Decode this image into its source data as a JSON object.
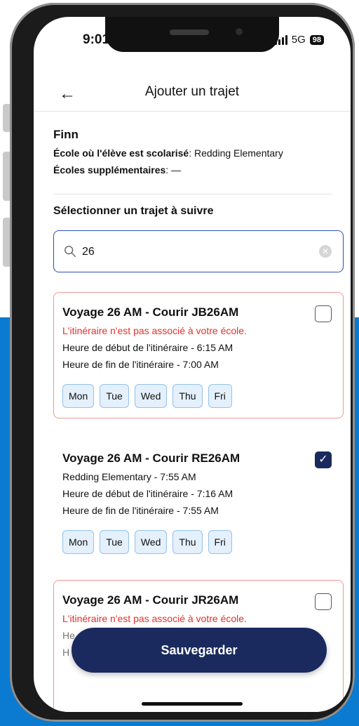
{
  "status_bar": {
    "time": "9:01",
    "network": "5G",
    "battery": "98"
  },
  "header": {
    "back_icon": "arrow-left-icon",
    "title": "Ajouter un trajet"
  },
  "student": {
    "name": "Finn",
    "school_label": "École où l'élève est scolarisé",
    "school_value": ": Redding Elementary",
    "extra_schools_label": "Écoles supplémentaires",
    "extra_schools_value": ": —"
  },
  "section_title": "Sélectionner un trajet à suivre",
  "search": {
    "value": "26",
    "icon": "search-icon",
    "clear_icon": "clear-icon"
  },
  "trips": [
    {
      "title": "Voyage 26 AM - Courir JB26AM",
      "warning": "L'itinéraire n'est pas associé à votre école.",
      "start": "Heure de début de l'itinéraire - 6:15 AM",
      "end": "Heure de fin de l'itinéraire - 7:00 AM",
      "checked": false,
      "days": [
        "Mon",
        "Tue",
        "Wed",
        "Thu",
        "Fri"
      ]
    },
    {
      "title": "Voyage 26 AM - Courir RE26AM",
      "school_time": "Redding Elementary - 7:55 AM",
      "start": "Heure de début de l'itinéraire - 7:16 AM",
      "end": "Heure de fin de l'itinéraire - 7:55 AM",
      "checked": true,
      "days": [
        "Mon",
        "Tue",
        "Wed",
        "Thu",
        "Fri"
      ]
    },
    {
      "title": "Voyage 26 AM - Courir JR26AM",
      "warning": "L'itinéraire n'est pas associé à votre école.",
      "start_partial": "He",
      "end_partial": "H",
      "checked": false
    }
  ],
  "save_button": "Sauvegarder",
  "colors": {
    "primary": "#1b2a5e",
    "accent_border": "#2c4fb8",
    "error": "#e0302a",
    "background_blue": "#0a7bd0"
  }
}
